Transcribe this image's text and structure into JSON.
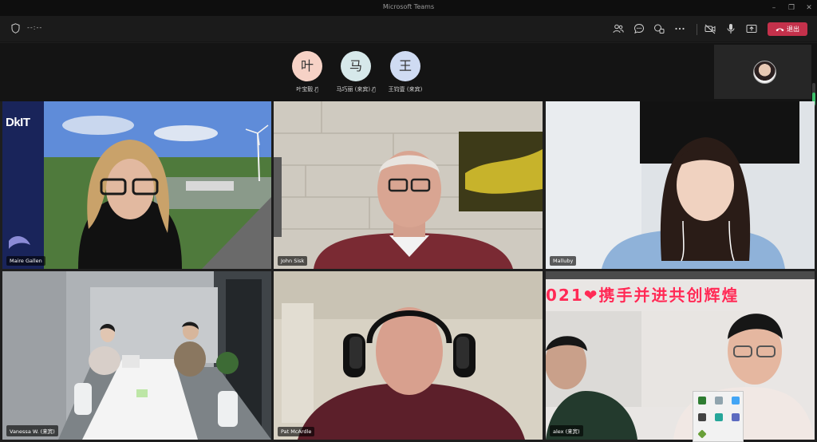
{
  "window": {
    "title": "Microsoft Teams",
    "minimize": "–",
    "maximize": "❐",
    "close": "✕"
  },
  "toolbar": {
    "timer": "--:--",
    "icons": [
      "people-icon",
      "chat-icon",
      "reactions-icon",
      "more-icon",
      "camera-off-icon",
      "mic-icon",
      "share-icon"
    ],
    "leave_label": "退出",
    "leave_color": "#c4314b"
  },
  "audio_participants": [
    {
      "initial": "叶",
      "name": "叶宝毅",
      "color": "#f6d2c6"
    },
    {
      "initial": "马",
      "name": "马巧丽 (来宾)",
      "color": "#d6e8ea"
    },
    {
      "initial": "王",
      "name": "王钧壹 (来宾)",
      "color": "#cfdbf2"
    }
  ],
  "tiles": [
    {
      "name": "Maire Gallen",
      "logo": "DkIT",
      "active": true
    },
    {
      "name": "John Sisk"
    },
    {
      "name": "Malluby"
    },
    {
      "name": "Vanessa W. (来宾)"
    },
    {
      "name": "Pat McArdle"
    },
    {
      "name": "alex (来宾)",
      "banner": "021❤携手并进共创辉煌"
    }
  ],
  "accent_color": "#8f94ff"
}
